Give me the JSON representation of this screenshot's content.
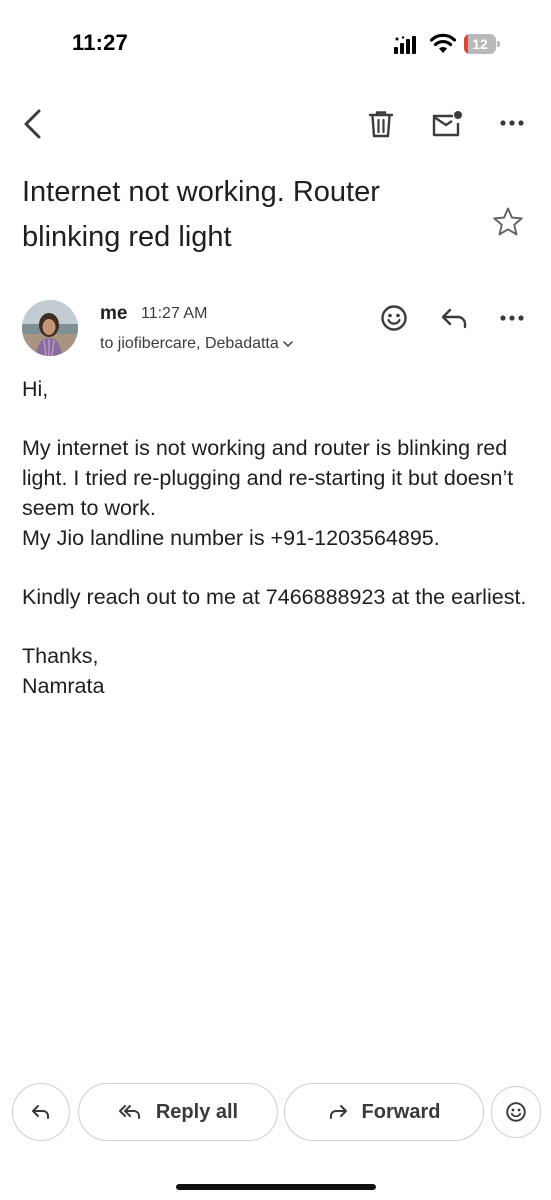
{
  "status_bar": {
    "time": "11:27",
    "battery_level": "12",
    "battery_color": "#e0433a"
  },
  "toolbar": {
    "icons": [
      "back-icon",
      "trash-icon",
      "mark-unread-icon",
      "more-icon"
    ]
  },
  "email": {
    "subject": "Internet not working. Router blinking red light",
    "sender": "me",
    "time": "11:27 AM",
    "recipients": "to jiofibercare, Debadatta",
    "body": [
      "Hi,",
      "My internet is not working and router is blinking red light. I tried re-plugging and re-starting it but doesn’t seem to work.",
      "My Jio landline number is +91-1203564895.",
      "Kindly reach out to me at 7466888923 at the earliest.",
      "Thanks,",
      "Namrata"
    ]
  },
  "actions": {
    "reply_all_label": "Reply all",
    "forward_label": "Forward"
  }
}
